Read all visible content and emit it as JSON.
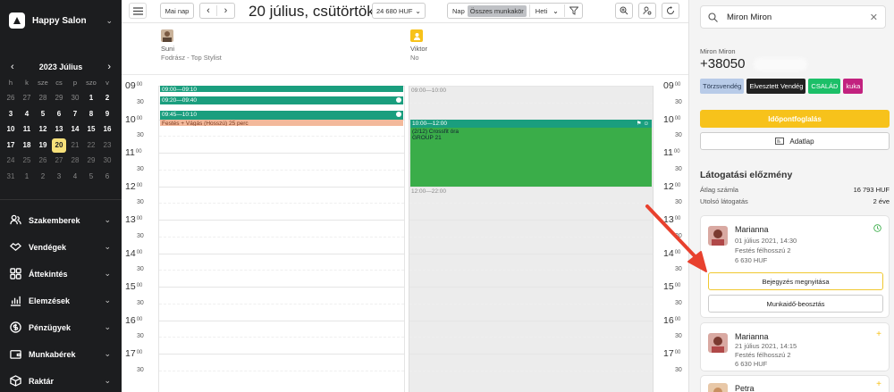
{
  "sidebar": {
    "brand": "Happy Salon",
    "calendar": {
      "month_title": "2023 Július",
      "prev": "‹",
      "next": "›",
      "weekdays": [
        "h",
        "k",
        "sze",
        "cs",
        "p",
        "szo",
        "v"
      ],
      "weeks": [
        [
          "26",
          "27",
          "28",
          "29",
          "30",
          "1",
          "2"
        ],
        [
          "3",
          "4",
          "5",
          "6",
          "7",
          "8",
          "9"
        ],
        [
          "10",
          "11",
          "12",
          "13",
          "14",
          "15",
          "16"
        ],
        [
          "17",
          "18",
          "19",
          "20",
          "21",
          "22",
          "23"
        ],
        [
          "24",
          "25",
          "26",
          "27",
          "28",
          "29",
          "30"
        ],
        [
          "31",
          "1",
          "2",
          "3",
          "4",
          "5",
          "6"
        ]
      ],
      "selected_day": "20"
    },
    "nav": [
      {
        "label": "Szakemberek",
        "icon": "users-icon"
      },
      {
        "label": "Vendégek",
        "icon": "handshake-icon"
      },
      {
        "label": "Áttekintés",
        "icon": "dashboard-icon"
      },
      {
        "label": "Elemzések",
        "icon": "chart-icon"
      },
      {
        "label": "Pénzügyek",
        "icon": "money-icon"
      },
      {
        "label": "Munkabérek",
        "icon": "wallet-icon"
      },
      {
        "label": "Raktár",
        "icon": "box-icon"
      }
    ]
  },
  "toolbar": {
    "today_label": "Mai nap",
    "prev": "‹",
    "next": "›",
    "date_title": "20 július, csütörtök",
    "revenue": "24 680 HUF",
    "view_day": "Nap",
    "view_all_roles": "Összes munkakör",
    "view_week": "Heti"
  },
  "staff": [
    {
      "name": "Suni",
      "role": "Fodrász - Top Stylist"
    },
    {
      "name": "Viktor",
      "role": "No"
    }
  ],
  "grid": {
    "hours": [
      "09",
      "10",
      "11",
      "12",
      "13",
      "14",
      "15",
      "16",
      "17"
    ],
    "minute_label": "00",
    "half_label": "30",
    "col1_appointments": [
      {
        "time": "09:00—09:10"
      },
      {
        "time": "09:20—09:40",
        "note": "Hajvágás, Hosszú"
      },
      {
        "time": "09:45—10:10"
      },
      {
        "title": "Festés + Vágás (Hosszú) 25 perc"
      }
    ],
    "col2_blocks": [
      {
        "time": "09:00—10:00"
      },
      {
        "time": "12:00—22:00"
      }
    ],
    "col2_appointment": {
      "time": "10:00—12:00",
      "title": "(2/12) Crossfit óra",
      "group": "GROUP 21"
    }
  },
  "panel": {
    "search_value": "Miron Miron",
    "client_name": "Miron Miron",
    "client_phone": "+38050",
    "tags": [
      {
        "label": "Törzsvendég",
        "bg": "#b8cbe8",
        "color": "#2a3b55"
      },
      {
        "label": "Elvesztett Vendég",
        "bg": "#222222",
        "color": "#ffffff"
      },
      {
        "label": "CSALÁD",
        "bg": "#1cbf68",
        "color": "#ffffff"
      },
      {
        "label": "kuka",
        "bg": "#c2227f",
        "color": "#ffffff"
      }
    ],
    "book_button": "Időpontfoglalás",
    "details_button": "Adatlap",
    "history_title": "Látogatási előzmény",
    "avg_label": "Átlag számla",
    "avg_value": "16 793 HUF",
    "last_label": "Utolsó látogatás",
    "last_value": "2 éve",
    "visits": [
      {
        "name": "Marianna",
        "date": "01 július 2021, 14:30",
        "service": "Festés félhosszú 2",
        "price": "6 630 HUF"
      },
      {
        "name": "Marianna",
        "date": "21 július 2021, 14:15",
        "service": "Festés félhosszú 2",
        "price": "6 630 HUF"
      },
      {
        "name": "Petra"
      }
    ],
    "open_entry_button": "Bejegyzés megnyitása",
    "schedule_button": "Munkaidő-beosztás"
  },
  "colors": {
    "accent_yellow": "#f7c21b",
    "teal": "#1a9e7e",
    "green": "#3aad49",
    "arrow": "#e8412e"
  }
}
